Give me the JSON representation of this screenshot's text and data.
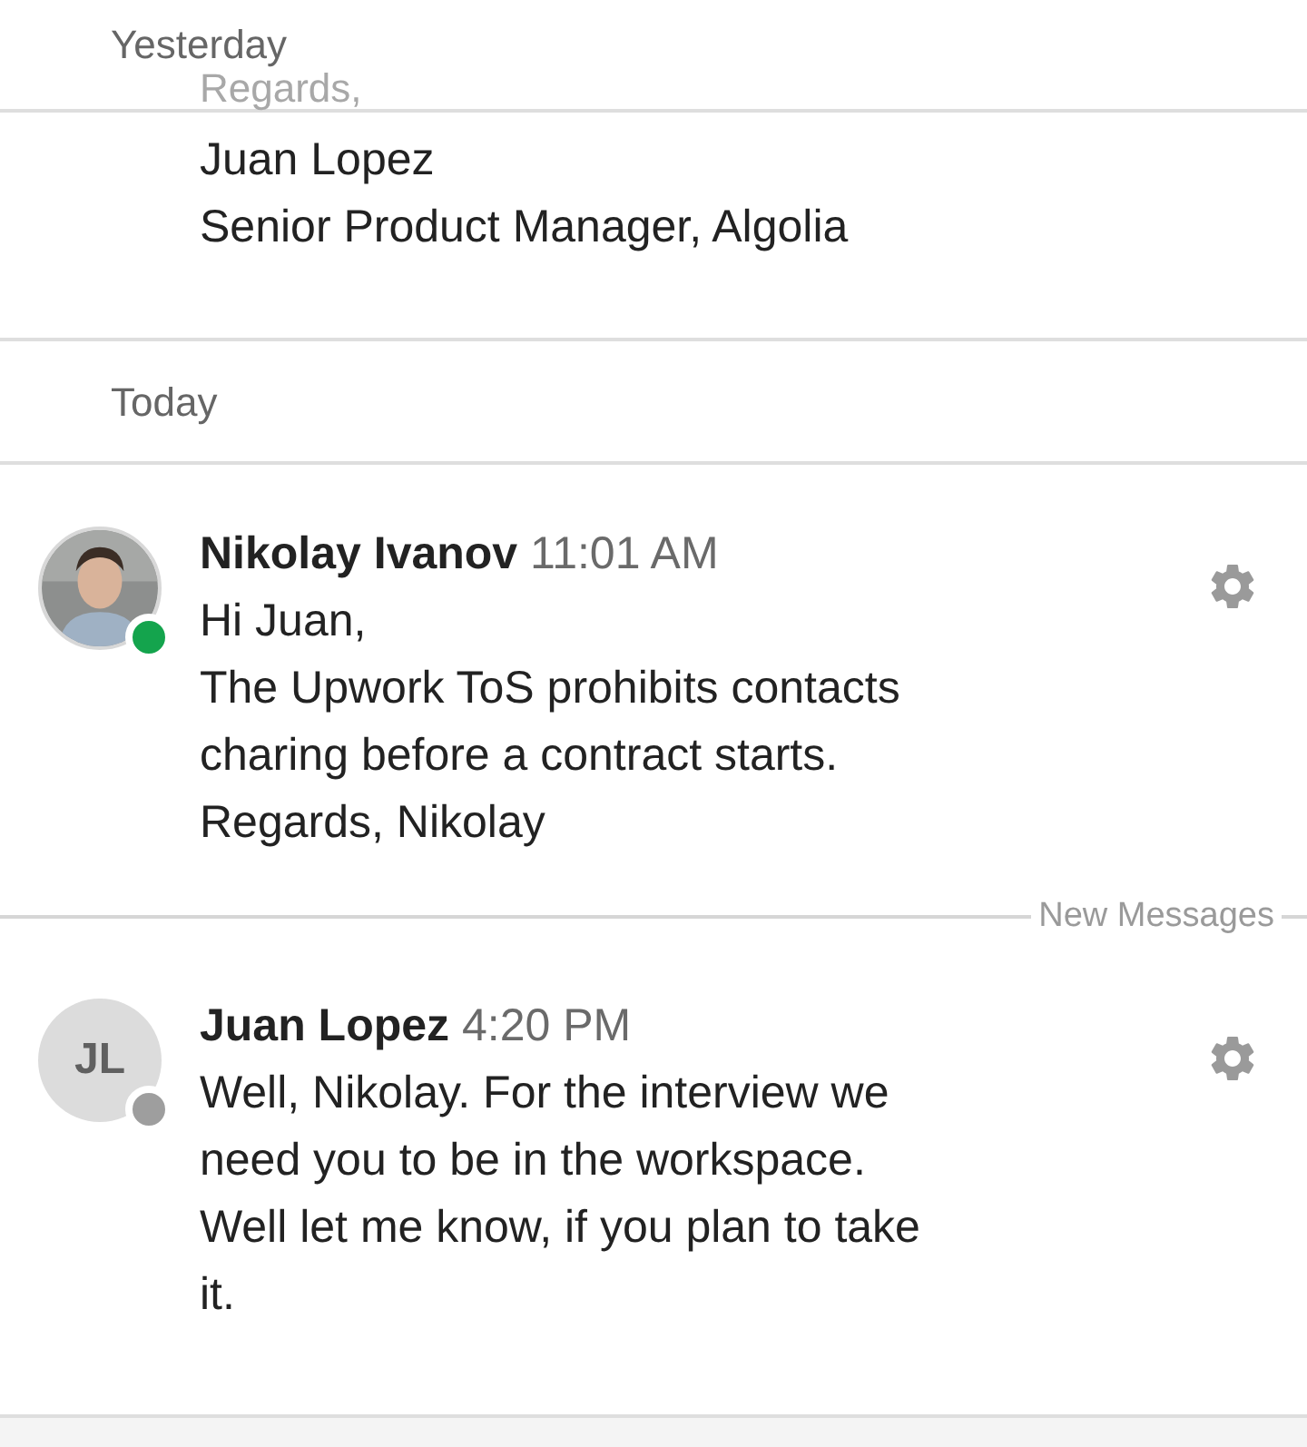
{
  "sections": [
    {
      "label": "Yesterday",
      "faded_line": "Regards,",
      "lines": [
        "Juan Lopez",
        "Senior Product Manager, Algolia"
      ]
    },
    {
      "label": "Today",
      "messages": [
        {
          "sender": "Nikolay Ivanov",
          "time": "11:01 AM",
          "color": "#14a44d",
          "lines": [
            "Hi Juan,",
            "The Upwork ToS prohibits contacts",
            "charing before a contract starts.",
            "Regards, Nikolay"
          ],
          "divider_after": "New Messages"
        },
        {
          "sender": "Juan Lopez",
          "time": "4:20 PM",
          "avatar": {
            "kind": "initials",
            "text": "JL"
          },
          "color": "#9e9e9e",
          "lines": [
            "Well, Nikolay. For the interview we",
            "need you to be in the workspace.",
            "Well let me know, if you plan to take",
            "it."
          ]
        }
      ]
    }
  ]
}
